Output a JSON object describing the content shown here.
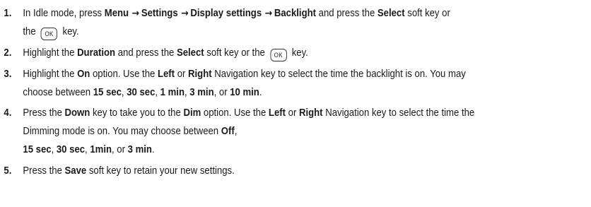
{
  "steps": [
    {
      "num": "1.",
      "l1a": "In Idle mode, press ",
      "menu": "Menu",
      "settings": "Settings",
      "display": "Display settings",
      "backlight": "Backlight",
      "l1b": " and press the ",
      "select": "Select",
      "l1c": " soft key or",
      "l2a": "the ",
      "key": "OK",
      "l2b": " key."
    },
    {
      "num": "2.",
      "a": "Highlight the ",
      "duration": "Duration",
      "b": " and press the ",
      "select": "Select",
      "c": " soft key or the ",
      "key": "OK",
      "d": " key."
    },
    {
      "num": "3.",
      "a": "Highlight the ",
      "on": "On",
      "b": " option. Use the ",
      "left": "Left",
      "or": " or ",
      "right": "Right",
      "c": " Navigation key to select the time the backlight is on. You may",
      "d": "choose between ",
      "o1": "15 sec",
      "s1": ", ",
      "o2": "30 sec",
      "s2": ", ",
      "o3": "1 min",
      "s3": ", ",
      "o4": "3 min",
      "s4": ", or ",
      "o5": "10 min",
      "end": "."
    },
    {
      "num": "4.",
      "a": "Press the ",
      "down": "Down",
      "b": " key to take you to the ",
      "dim": "Dim",
      "c": " option. Use the ",
      "left": "Left",
      "or": " or ",
      "right": "Right",
      "d": " Navigation key to select the time the",
      "e": "Dimming mode is on. You may choose between ",
      "off": "Off",
      "f": ",",
      "o1": "15 sec",
      "s1": ", ",
      "o2": "30 sec",
      "s2": ", ",
      "o3": "1min",
      "s3": ", or ",
      "o4": "3 min",
      "end": "."
    },
    {
      "num": "5.",
      "a": "Press the ",
      "save": "Save",
      "b": " soft key to retain your new settings."
    }
  ],
  "arrow_glyph": "→"
}
